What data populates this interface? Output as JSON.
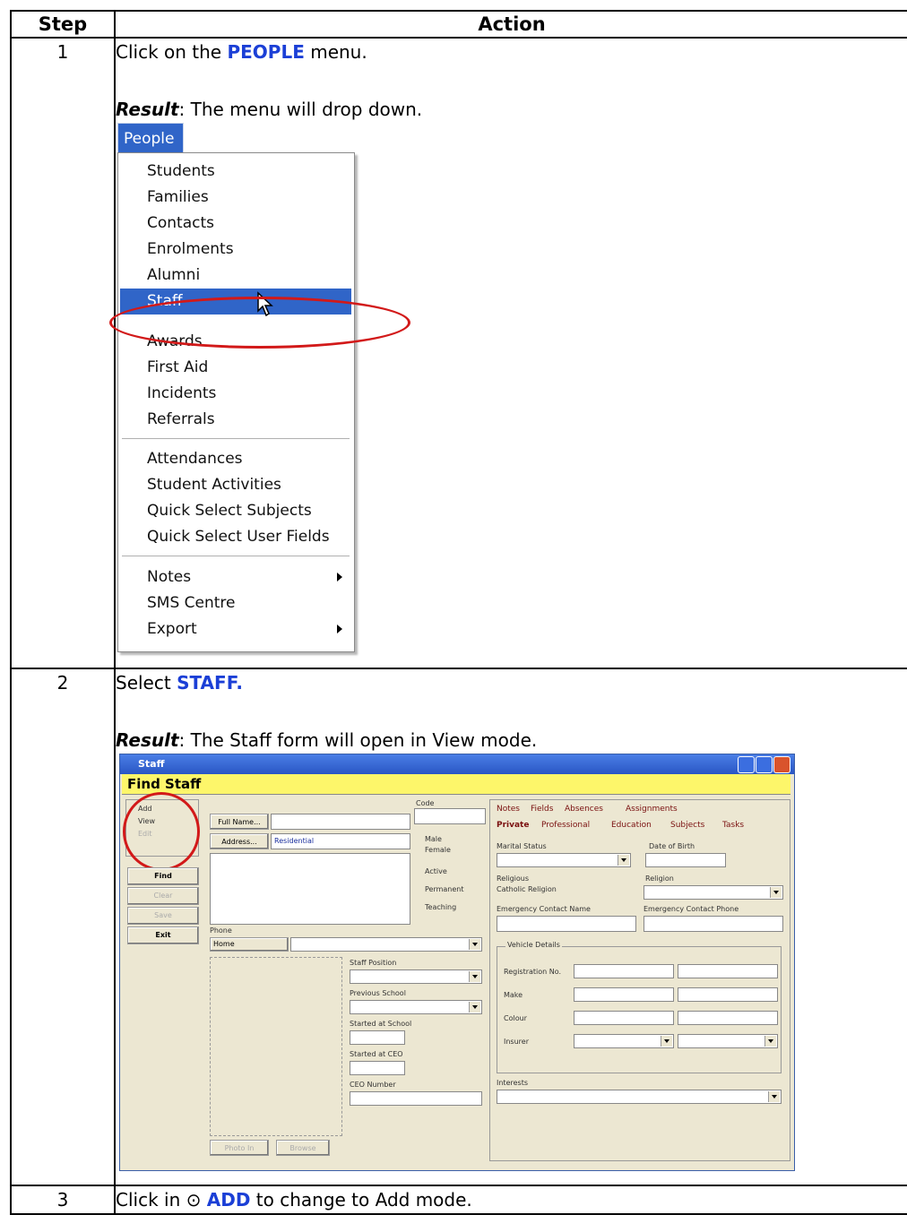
{
  "table": {
    "header_step": "Step",
    "header_action": "Action"
  },
  "rows": [
    {
      "step": "1",
      "line1_pre": "Click on the ",
      "line1_kw": "PEOPLE",
      "line1_post": " menu.",
      "result_label": "Result",
      "result_text": ": The menu will drop down."
    },
    {
      "step": "2",
      "line1_pre": "Select ",
      "line1_kw": "STAFF.",
      "result_label": "Result",
      "result_text": ": The Staff form will open in View mode."
    },
    {
      "step": "3",
      "line1_pre": "Click in ",
      "line1_icon": "⊙",
      "line1_kw": "ADD",
      "line1_post": " to change to Add mode."
    }
  ],
  "people_menu": {
    "title": "People",
    "items": [
      "Students",
      "Families",
      "Contacts",
      "Enrolments",
      "Alumni",
      "Staff",
      "Awards",
      "First Aid",
      "Incidents",
      "Referrals",
      "Attendances",
      "Student Activities",
      "Quick Select Subjects",
      "Quick Select User Fields",
      "Notes",
      "SMS Centre",
      "Export"
    ],
    "selected": "Staff",
    "submenu_items": [
      "Notes",
      "Export"
    ],
    "highlight_color": "#3065c8",
    "circle_color": "#d21919"
  },
  "staff_window": {
    "title": "Staff",
    "find_bar": "Find Staff",
    "modes": [
      "Add",
      "View",
      "Edit"
    ],
    "selected_mode": "View",
    "side_buttons": [
      "Find",
      "Clear",
      "Save",
      "Exit"
    ],
    "full_name_btn": "Full Name...",
    "address_btn": "Address...",
    "address_type": "Residential",
    "code_label": "Code",
    "gender": [
      "Male",
      "Female"
    ],
    "checks": [
      "Active",
      "Permanent",
      "Teaching"
    ],
    "phone_label": "Phone",
    "phone_type": "Home",
    "staff_position": "Staff Position",
    "previous_school": "Previous School",
    "started_school": "Started at School",
    "started_ceo": "Started at CEO",
    "ceo_number": "CEO Number",
    "photo_btns": [
      "Photo In",
      "Browse"
    ],
    "tabs_top": [
      "Notes",
      "Fields",
      "Absences",
      "Assignments"
    ],
    "tabs_bottom": [
      "Private",
      "Professional",
      "Education",
      "Subjects",
      "Tasks"
    ],
    "marital_status": "Marital Status",
    "dob": "Date of Birth",
    "religious": "Religious",
    "catholic_religion": "Catholic Religion",
    "religion": "Religion",
    "ec_name": "Emergency Contact Name",
    "ec_phone": "Emergency Contact Phone",
    "vehicle_details": "Vehicle Details",
    "vehicle_fields": [
      "Registration No.",
      "Make",
      "Colour",
      "Insurer"
    ],
    "interests": "Interests",
    "titlebar_color": "#2a56c4",
    "find_bar_color": "#fdf66a"
  }
}
